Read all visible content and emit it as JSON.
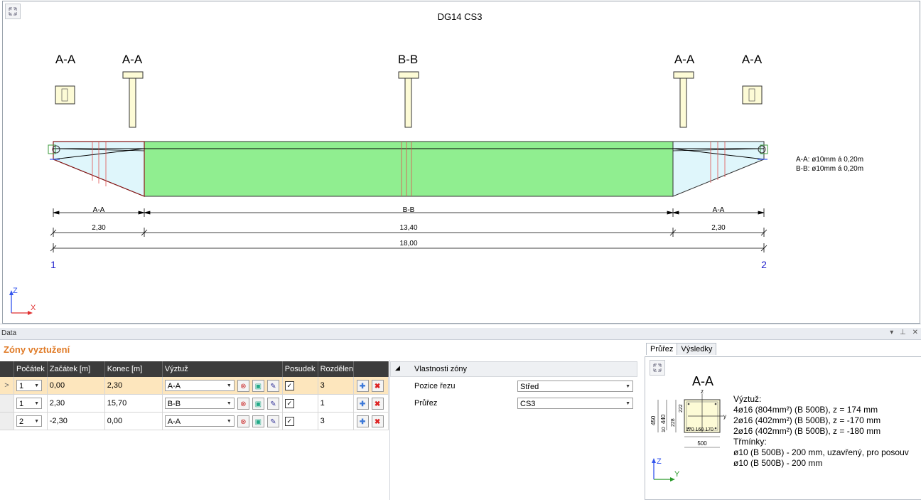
{
  "drawing": {
    "title": "DG14 CS3",
    "section_labels": [
      "A-A",
      "A-A",
      "B-B",
      "A-A",
      "A-A"
    ],
    "zone_labels": [
      "A-A",
      "B-B",
      "A-A"
    ],
    "zone_lengths": [
      "2,30",
      "13,40",
      "2,30"
    ],
    "total_length": "18,00",
    "node_start": "1",
    "node_end": "2",
    "legend": [
      "A-A: ø10mm á 0,20m",
      "B-B: ø10mm á 0,20m"
    ],
    "axis_z": "Z",
    "axis_x": "X"
  },
  "panel": {
    "title": "Data",
    "zones_title": "Zóny vyztužení"
  },
  "grid": {
    "columns": [
      "Počátek",
      "Začátek [m]",
      "Konec [m]",
      "Výztuž",
      "Posudek",
      "Rozdělení"
    ],
    "rows": [
      {
        "origin": "1",
        "start": "0,00",
        "end": "2,30",
        "reinforcement": "A-A",
        "check": "✓",
        "division": "3"
      },
      {
        "origin": "1",
        "start": "2,30",
        "end": "15,70",
        "reinforcement": "B-B",
        "check": "✓",
        "division": "1"
      },
      {
        "origin": "2",
        "start": "-2,30",
        "end": "0,00",
        "reinforcement": "A-A",
        "check": "✓",
        "division": "3"
      }
    ],
    "row_marker": ">"
  },
  "props": {
    "header": "Vlastnosti zóny",
    "cut_position_label": "Pozice řezu",
    "cut_position_value": "Střed",
    "section_label": "Průřez",
    "section_value": "CS3"
  },
  "preview": {
    "tabs": [
      "Průřez",
      "Výsledky"
    ],
    "section_title": "A-A",
    "lines": [
      "Výztuž:",
      "4ø16 (804mm²) (B 500B), z = 174 mm",
      "2ø16 (402mm²) (B 500B), z = -170 mm",
      "2ø16 (402mm²) (B 500B), z = -180 mm",
      "Třmínky:",
      "ø10 (B 500B) - 200 mm, uzavřený, pro posouv",
      "ø10 (B 500B) - 200 mm"
    ],
    "dims": {
      "h": "450",
      "h2": "440",
      "t": "10",
      "a": "222",
      "b": "228",
      "bottom": "170 160 170",
      "width": "500"
    },
    "axis_z": "Z",
    "axis_y": "Y",
    "z_label": "z",
    "y_label": "y"
  },
  "colors": {
    "accent": "#e07b27",
    "beam_green": "#90ee90",
    "haunch_blue": "#dff6fb",
    "section_fill": "#fdfbd6",
    "grid_header": "#3c3c3c",
    "selected_row": "#fde6bd"
  }
}
